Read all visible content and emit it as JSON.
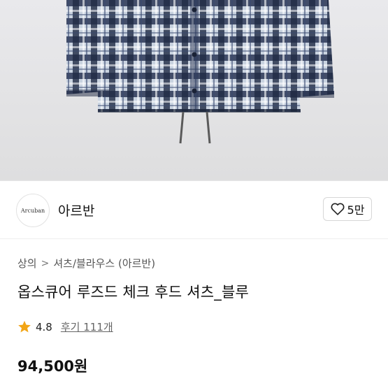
{
  "brand": {
    "logo_text": "Arcuban",
    "name": "아르반"
  },
  "like": {
    "count_label": "5만"
  },
  "breadcrumb": {
    "category": "상의",
    "separator": ">",
    "subcategory": "셔츠/블라우스 (아르반)"
  },
  "product": {
    "title": "옵스큐어 루즈드 체크 후드 셔츠_블루",
    "rating": "4.8",
    "reviews_label": "후기 111개",
    "price": "94,500원"
  },
  "colors": {
    "star": "#f2a516",
    "plaid_dark": "#1f2a44",
    "plaid_light": "#c9d3e0"
  }
}
